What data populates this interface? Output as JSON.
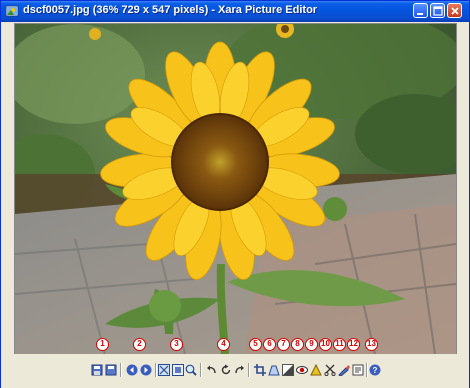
{
  "window": {
    "title": "dscf0057.jpg (36% 729 x 547 pixels) - Xara Picture Editor"
  },
  "markers": [
    "1",
    "2",
    "3",
    "4",
    "5",
    "6",
    "7",
    "8",
    "9",
    "10",
    "11",
    "12",
    "13"
  ],
  "tools": [
    "save-as-icon",
    "save-icon",
    "previous-icon",
    "next-icon",
    "fit-to-window-icon",
    "actual-size-icon",
    "zoom-icon",
    "undo-icon",
    "rotate-icon",
    "redo-icon",
    "crop-icon",
    "perspective-icon",
    "lighting-icon",
    "red-eye-icon",
    "sharpen-icon",
    "cut-icon",
    "retouch-icon",
    "export-icon",
    "help-icon"
  ]
}
